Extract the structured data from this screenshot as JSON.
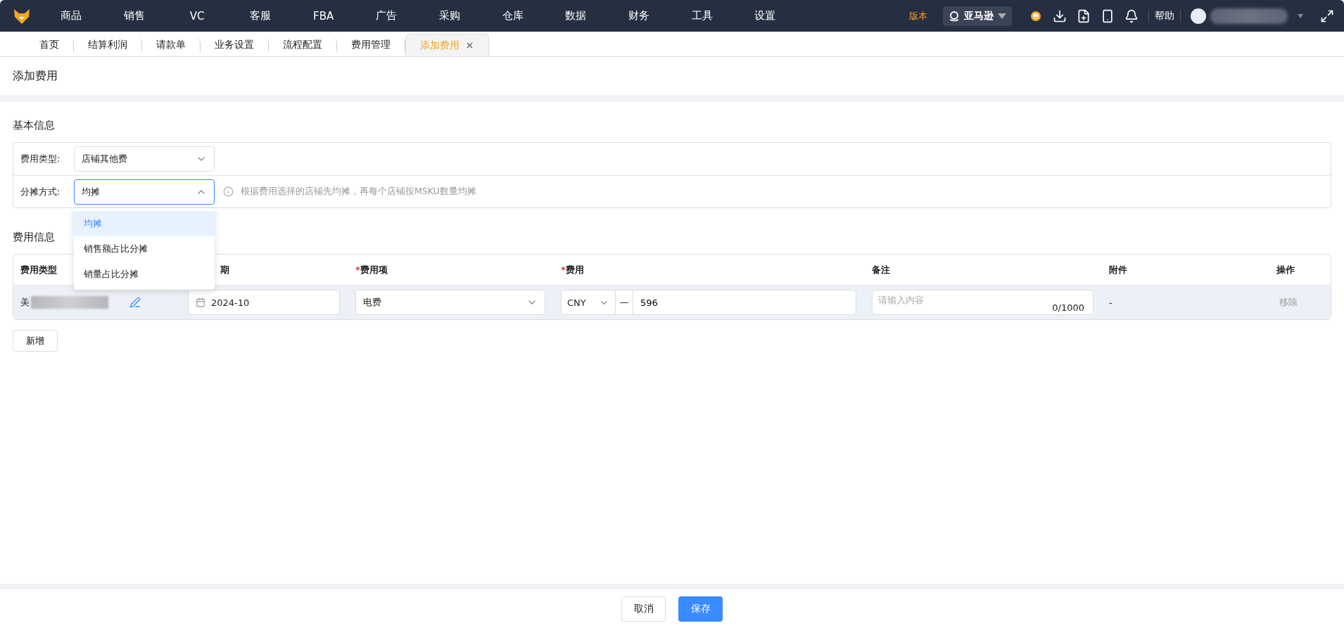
{
  "nav": {
    "items": [
      "商品",
      "销售",
      "VC",
      "客服",
      "FBA",
      "广告",
      "采购",
      "仓库",
      "数据",
      "财务",
      "工具",
      "设置"
    ]
  },
  "header_right": {
    "version": "版本",
    "platform": "亚马逊",
    "help": "帮助"
  },
  "tabs": [
    {
      "label": "首页",
      "selected": false,
      "closable": false
    },
    {
      "label": "结算利润",
      "selected": false,
      "closable": false
    },
    {
      "label": "请款单",
      "selected": false,
      "closable": false
    },
    {
      "label": "业务设置",
      "selected": false,
      "closable": false
    },
    {
      "label": "流程配置",
      "selected": false,
      "closable": false
    },
    {
      "label": "费用管理",
      "selected": false,
      "closable": false
    },
    {
      "label": "添加费用",
      "selected": true,
      "closable": true
    }
  ],
  "page_title": "添加费用",
  "basic_info": {
    "title": "基本信息",
    "fields": [
      {
        "label": "费用类型:",
        "value": "店铺其他费",
        "expanded": false
      },
      {
        "label": "分摊方式:",
        "value": "均摊",
        "expanded": true,
        "hint": "根据费用选择的店铺先均摊，再每个店铺按MSKU数量均摊",
        "options": [
          {
            "label": "均摊",
            "selected": true
          },
          {
            "label": "销售额占比分摊",
            "selected": false
          },
          {
            "label": "销量占比分摊",
            "selected": false
          }
        ]
      }
    ]
  },
  "expense_info": {
    "title": "费用信息",
    "columns": [
      {
        "label": "费用类型"
      },
      {
        "label": "期"
      },
      {
        "label": "费用项",
        "required_mark": "*"
      },
      {
        "label": "费用",
        "required_mark": "*"
      },
      {
        "label": "备注"
      },
      {
        "label": "附件"
      },
      {
        "label": "操作"
      }
    ],
    "rows": [
      {
        "store": "美",
        "date": "2024-10",
        "item": "电费",
        "currency": "CNY",
        "separator": "—",
        "amount": "596",
        "note_placeholder": "请输入内容",
        "note_count": "0/1000",
        "attachment": "-",
        "action": "移除"
      }
    ]
  },
  "add_button": "新增",
  "footer": {
    "buttons": [
      {
        "label": "取消",
        "kind": "default"
      },
      {
        "label": "保存",
        "kind": "primary"
      }
    ]
  }
}
